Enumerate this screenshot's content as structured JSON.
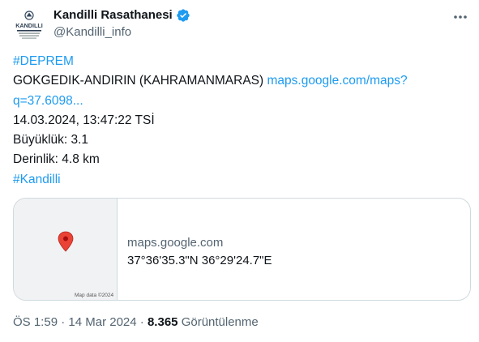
{
  "author": {
    "display_name": "Kandilli Rasathanesi",
    "handle": "@Kandilli_info",
    "logo_text": "KANDILLI",
    "logo_subtext": "RASATHANESİ VE DEPREM ARAŞTIRMA ENSTİTÜSÜ"
  },
  "tweet": {
    "hashtag_top": "#DEPREM",
    "location": "GOKGEDIK-ANDIRIN (KAHRAMANMARAS)",
    "map_link_1": "maps.google.com/maps?",
    "map_link_2": "q=37.6098...",
    "datetime": "14.03.2024, 13:47:22 TSİ",
    "magnitude": "Büyüklük: 3.1",
    "depth": "Derinlik: 4.8 km",
    "hashtag_bottom": "#Kandilli"
  },
  "card": {
    "domain": "maps.google.com",
    "coordinates": "37°36'35.3\"N 36°29'24.7\"E",
    "map_credit": "Map data ©2024"
  },
  "meta": {
    "time": "ÖS 1:59",
    "separator": "·",
    "date": "14 Mar 2024",
    "views_count": "8.365",
    "views_label": "Görüntülenme"
  },
  "colors": {
    "link": "#1d9bf0",
    "text": "#0f1419",
    "secondary": "#536471",
    "border": "#cfd9de",
    "map_pin": "#ea4335"
  },
  "icons": {
    "verified": "verified-badge-icon",
    "more": "more-options-icon",
    "pin": "map-pin-icon"
  }
}
